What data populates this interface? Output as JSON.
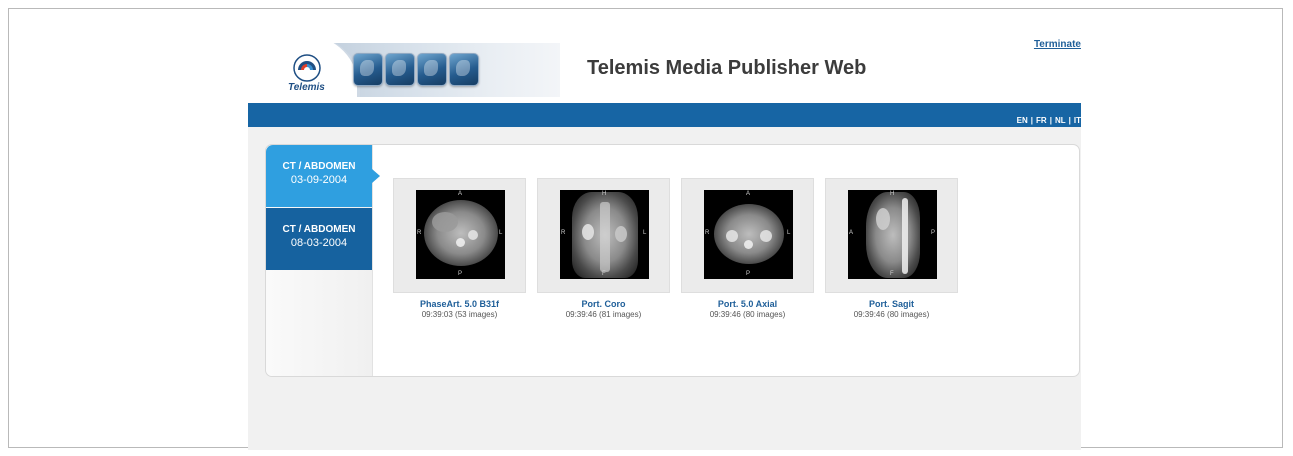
{
  "header": {
    "logo_text": "Telemis",
    "app_title": "Telemis Media Publisher Web",
    "terminate_label": "Terminate",
    "logo_tiles": [
      "xray-hand-icon",
      "scanner-icon",
      "monitor-icon",
      "screen-icon"
    ]
  },
  "languages": [
    "EN",
    "FR",
    "NL",
    "IT"
  ],
  "language_separator": "|",
  "studies": [
    {
      "title": "CT / ABDOMEN",
      "date": "03-09-2004",
      "active": true
    },
    {
      "title": "CT / ABDOMEN",
      "date": "08-03-2004",
      "active": false
    }
  ],
  "series": [
    {
      "name": "PhaseArt. 5.0 B31f",
      "meta": "09:39:03 (53 images)",
      "view": "axial",
      "orient": {
        "top": "A",
        "bottom": "P",
        "left": "R",
        "right": "L"
      }
    },
    {
      "name": "Port. Coro",
      "meta": "09:39:46 (81 images)",
      "view": "coronal",
      "orient": {
        "top": "H",
        "bottom": "F",
        "left": "R",
        "right": "L"
      }
    },
    {
      "name": "Port. 5.0 Axial",
      "meta": "09:39:46 (80 images)",
      "view": "axial",
      "orient": {
        "top": "A",
        "bottom": "P",
        "left": "R",
        "right": "L"
      }
    },
    {
      "name": "Port. Sagit",
      "meta": "09:39:46 (80 images)",
      "view": "sagittal",
      "orient": {
        "top": "H",
        "bottom": "F",
        "left": "A",
        "right": "P"
      }
    }
  ],
  "colors": {
    "brand_blue": "#1765a4",
    "active_study": "#2f9fe0",
    "inactive_study": "#16629f",
    "link": "#1f5f99"
  }
}
